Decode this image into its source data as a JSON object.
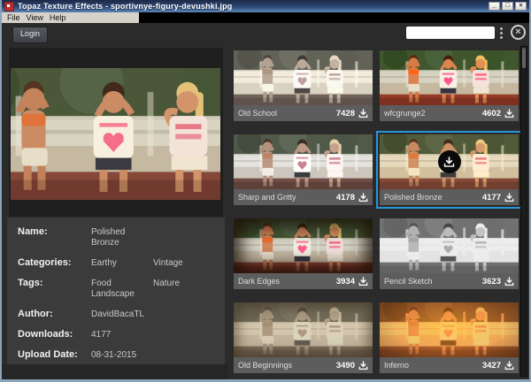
{
  "window": {
    "title": "Topaz Texture Effects - sportivnye-figury-devushki.jpg",
    "controls": {
      "minimize": "_",
      "maximize": "□",
      "close": "×"
    }
  },
  "menu": {
    "items": [
      {
        "label": "File"
      },
      {
        "label": "View"
      },
      {
        "label": "Help"
      }
    ]
  },
  "toolbar": {
    "login_label": "Login",
    "search": {
      "value": "",
      "placeholder": ""
    },
    "close_icon_glyph": "×"
  },
  "icons": {
    "app-icon": "topaz-red-square",
    "search-menu-icon": "vertical-three-dots",
    "panel-close-icon": "circled-x",
    "download-icon": "arrow-down-into-tray"
  },
  "details": {
    "rows": [
      {
        "label": "Name:",
        "cols": [
          [
            "Polished Bronze"
          ]
        ]
      },
      {
        "label": "Categories:",
        "cols": [
          [
            "Earthy"
          ],
          [
            "Vintage"
          ]
        ]
      },
      {
        "label": "Tags:",
        "cols": [
          [
            "Food",
            "Landscape"
          ],
          [
            "Nature"
          ]
        ]
      },
      {
        "label": "Author:",
        "cols": [
          [
            "DavidBacaTL"
          ]
        ]
      },
      {
        "label": "Downloads:",
        "cols": [
          [
            "4177"
          ]
        ]
      },
      {
        "label": "Upload Date:",
        "cols": [
          [
            "08-31-2015"
          ]
        ]
      }
    ]
  },
  "effects": {
    "items": [
      {
        "name": "Old School",
        "downloads": "7428",
        "selected": false,
        "style": "old-school"
      },
      {
        "name": "wfcgrunge2",
        "downloads": "4602",
        "selected": false,
        "style": "wfcgrunge2"
      },
      {
        "name": "Sharp and Gritty",
        "downloads": "4178",
        "selected": false,
        "style": "sharp-gritty"
      },
      {
        "name": "Polished Bronze",
        "downloads": "4177",
        "selected": true,
        "style": "polished-bronze"
      },
      {
        "name": "Dark Edges",
        "downloads": "3934",
        "selected": false,
        "style": "dark-edges"
      },
      {
        "name": "Pencil Sketch",
        "downloads": "3623",
        "selected": false,
        "style": "pencil-sketch"
      },
      {
        "name": "Old Beginnings",
        "downloads": "3490",
        "selected": false,
        "style": "old-beginnings"
      },
      {
        "name": "Inferno",
        "downloads": "3427",
        "selected": false,
        "style": "inferno"
      }
    ]
  },
  "colors": {
    "accent_selection": "#2795d9",
    "window_bg": "#2b2b2b",
    "details_bg": "#3b3b3b",
    "label_bar_bg": "#5d5d5d",
    "titlebar_gradient_top": "#1d2947",
    "titlebar_gradient_bottom": "#5d86b6"
  }
}
